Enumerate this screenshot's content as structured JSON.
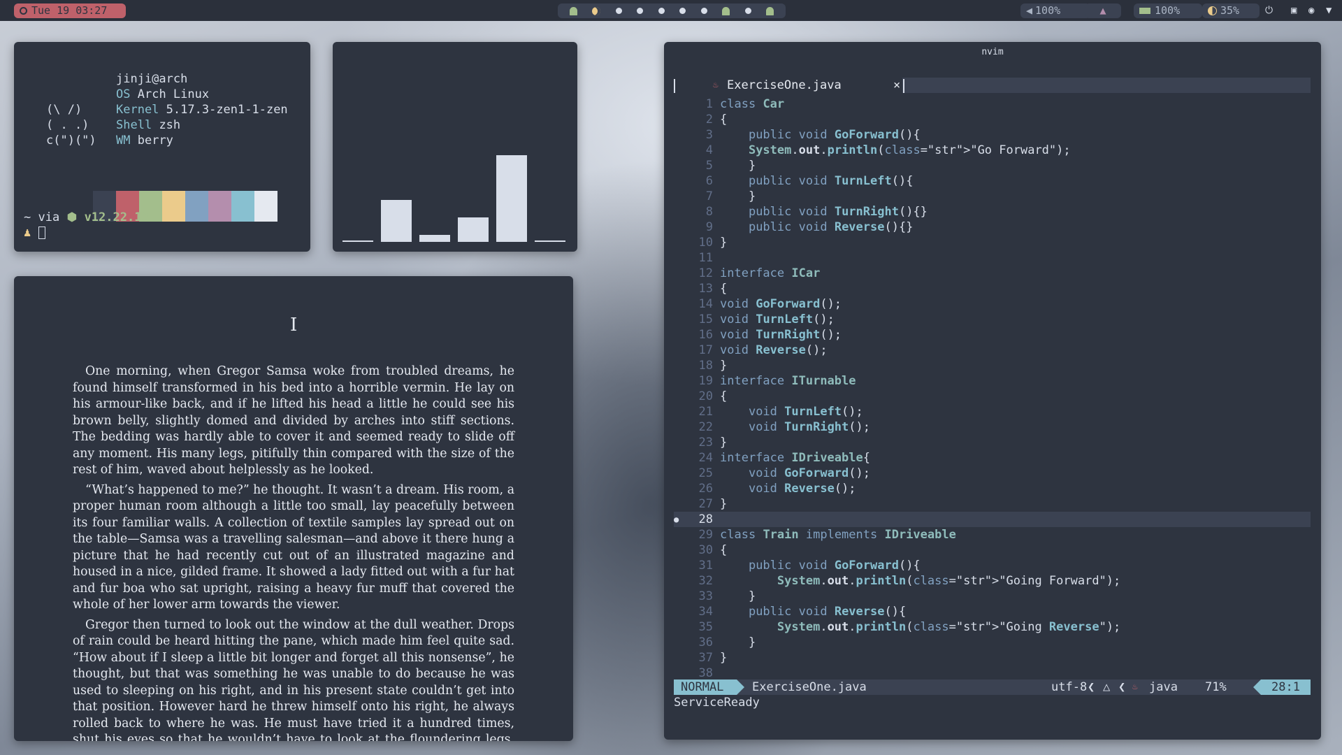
{
  "topbar": {
    "clock": "Tue 19 03:27",
    "volume": "100%",
    "battery": "100%",
    "brightness": "35%",
    "workspaces": [
      "ghost",
      "moon",
      "dot",
      "dot",
      "dot",
      "dot",
      "dot",
      "ghost",
      "dot",
      "ghost"
    ]
  },
  "fetch": {
    "user": "jinji@arch",
    "os_key": "OS",
    "os_val": "Arch Linux",
    "kernel_key": "Kernel",
    "kernel_val": "5.17.3-zen1-1-zen",
    "shell_key": "Shell",
    "shell_val": "zsh",
    "wm_key": "WM",
    "wm_val": "berry",
    "art1": "(\\ /)",
    "art2": "( . .)",
    "art3": "c(\")(\")",
    "prompt_dir": "~",
    "prompt_via": "via",
    "prompt_node": "v12.22.12",
    "palette": [
      "#3b4252",
      "#bf616a",
      "#a3be8c",
      "#ebcb8b",
      "#81a1c1",
      "#b48ead",
      "#88c0d0",
      "#e5e9f0"
    ]
  },
  "bars": [
    0.02,
    0.48,
    0.08,
    0.28,
    1.0,
    0.02
  ],
  "reader": {
    "paragraphs": [
      "One morning, when Gregor Samsa woke from troubled dreams, he found himself transformed in his bed into a horrible vermin. He lay on his armour-like back, and if he lifted his head a little he could see his brown belly, slightly domed and divided by arches into stiff sections. The bedding was hardly able to cover it and seemed ready to slide off any moment. His many legs, pitifully thin compared with the size of the rest of him, waved about helplessly as he looked.",
      "“What’s happened to me?” he thought. It wasn’t a dream. His room, a proper human room although a little too small, lay peacefully between its four familiar walls. A collection of textile samples lay spread out on the table—Samsa was a travelling salesman—and above it there hung a picture that he had recently cut out of an illustrated magazine and housed in a nice, gilded frame. It showed a lady fitted out with a fur hat and fur boa who sat upright, raising a heavy fur muff that covered the whole of her lower arm towards the viewer.",
      "Gregor then turned to look out the window at the dull weather. Drops of rain could be heard hitting the pane, which made him feel quite sad. “How about if I sleep a little bit longer and forget all this nonsense”, he thought, but that was something he was unable to do because he was used to sleeping on his right, and in his present state couldn’t get into that position. However hard he threw himself onto his right, he always rolled back to where he was. He must have tried it a hundred times, shut his eyes so that he wouldn’t have to look at the floundering legs, and"
    ]
  },
  "nvim": {
    "window_title": "nvim",
    "tab_name": "ExerciseOne.java",
    "tab_close": "×",
    "lines": [
      {
        "n": "1",
        "t": "class Car"
      },
      {
        "n": "2",
        "t": "{"
      },
      {
        "n": "3",
        "t": "    public void GoForward(){"
      },
      {
        "n": "4",
        "t": "    System.out.println(\"Go Forward\");"
      },
      {
        "n": "5",
        "t": "    }"
      },
      {
        "n": "6",
        "t": "    public void TurnLeft(){"
      },
      {
        "n": "7",
        "t": "    }"
      },
      {
        "n": "8",
        "t": "    public void TurnRight(){}"
      },
      {
        "n": "9",
        "t": "    public void Reverse(){}"
      },
      {
        "n": "10",
        "t": "}"
      },
      {
        "n": "11",
        "t": ""
      },
      {
        "n": "12",
        "t": "interface ICar"
      },
      {
        "n": "13",
        "t": "{"
      },
      {
        "n": "14",
        "t": "void GoForward();"
      },
      {
        "n": "15",
        "t": "void TurnLeft();"
      },
      {
        "n": "16",
        "t": "void TurnRight();"
      },
      {
        "n": "17",
        "t": "void Reverse();"
      },
      {
        "n": "18",
        "t": "}"
      },
      {
        "n": "19",
        "t": "interface ITurnable"
      },
      {
        "n": "20",
        "t": "{"
      },
      {
        "n": "21",
        "t": "    void TurnLeft();"
      },
      {
        "n": "22",
        "t": "    void TurnRight();"
      },
      {
        "n": "23",
        "t": "}"
      },
      {
        "n": "24",
        "t": "interface IDriveable{"
      },
      {
        "n": "25",
        "t": "    void GoForward();"
      },
      {
        "n": "26",
        "t": "    void Reverse();"
      },
      {
        "n": "27",
        "t": "}"
      },
      {
        "n": "28",
        "t": ""
      },
      {
        "n": "29",
        "t": "class Train implements IDriveable"
      },
      {
        "n": "30",
        "t": "{"
      },
      {
        "n": "31",
        "t": "    public void GoForward(){"
      },
      {
        "n": "32",
        "t": "        System.out.println(\"Going Forward\");"
      },
      {
        "n": "33",
        "t": "    }"
      },
      {
        "n": "34",
        "t": "    public void Reverse(){"
      },
      {
        "n": "35",
        "t": "        System.out.println(\"Going Reverse\");"
      },
      {
        "n": "36",
        "t": "    }"
      },
      {
        "n": "37",
        "t": "}"
      },
      {
        "n": "38",
        "t": ""
      }
    ],
    "current_line": "28",
    "status": {
      "mode": "NORMAL",
      "file": "ExerciseOne.java",
      "encoding": "utf-8",
      "filetype": "java",
      "percent": "71%",
      "position": "28:1"
    },
    "message": "ServiceReady"
  }
}
